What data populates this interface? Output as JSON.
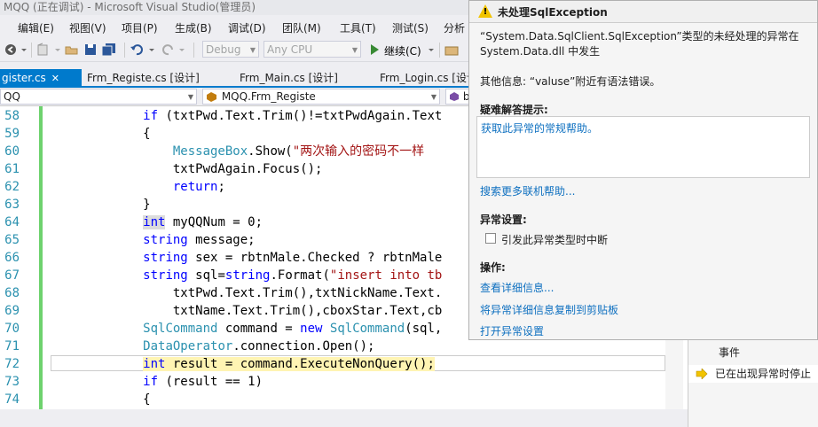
{
  "window": {
    "title": "MQQ (正在调试) - Microsoft Visual Studio(管理员)"
  },
  "menu": [
    "编辑(E)",
    "视图(V)",
    "项目(P)",
    "生成(B)",
    "调试(D)",
    "团队(M)",
    "工具(T)",
    "测试(S)",
    "分析"
  ],
  "toolbar": {
    "config": "Debug",
    "platform": "Any CPU",
    "continue_label": "继续(C)"
  },
  "tabs": [
    {
      "label": "gister.cs",
      "active": true
    },
    {
      "label": "Frm_Registe.cs [设计]",
      "active": false
    },
    {
      "label": "Frm_Main.cs [设计]",
      "active": false
    },
    {
      "label": "Frm_Login.cs [设计",
      "active": false
    }
  ],
  "navbar": {
    "project": "QQ",
    "class": "MQQ.Frm_Registe",
    "member": "b"
  },
  "editor": {
    "line_numbers": [
      "58",
      "59",
      "60",
      "61",
      "62",
      "63",
      "64",
      "65",
      "66",
      "67",
      "68",
      "69",
      "70",
      "71",
      "72",
      "73",
      "74"
    ]
  },
  "exception": {
    "title": "未处理SqlException",
    "message": "“System.Data.SqlClient.SqlException”类型的未经处理的异常在 System.Data.dll 中发生",
    "additional_info": "其他信息: “valuse”附近有语法错误。",
    "troubleshoot_label": "疑难解答提示:",
    "help_link": "获取此异常的常规帮助。",
    "search_link": "搜索更多联机帮助...",
    "settings_label": "异常设置:",
    "break_checkbox": "引发此异常类型时中断",
    "actions_label": "操作:",
    "actions": [
      "查看详细信息...",
      "将异常详细信息复制到剪贴板",
      "打开异常设置"
    ]
  },
  "right_panel": {
    "row1": "事件",
    "row2": "已在出现异常时停止"
  }
}
